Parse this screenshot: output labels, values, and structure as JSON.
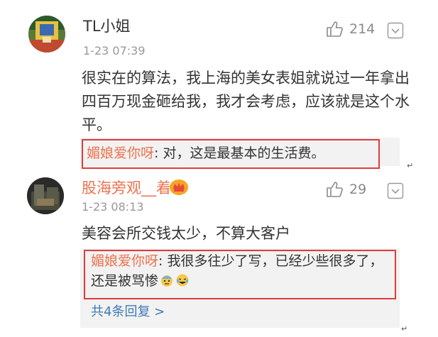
{
  "comments": [
    {
      "username": "TL小姐",
      "timestamp": "1-23 07:39",
      "likes": "214",
      "text": "很实在的算法，我上海的美女表姐就说过一年拿出四百万现金砸给我，我才会考虑，应该就是这个水平。",
      "reply": {
        "author": "媚娘爱你呀",
        "separator": ": ",
        "text": "对，这是最基本的生活费。"
      },
      "paragraph_mark": "↵"
    },
    {
      "username": "股海旁观__着",
      "badge_icon": "vip-crown-icon",
      "timestamp": "1-23 08:13",
      "likes": "29",
      "text": "美容会所交钱太少，不算大客户",
      "reply": {
        "author": "媚娘爱你呀",
        "separator": ": ",
        "text": "我很多往少了写，已经少些很多了，还是被骂惨"
      },
      "more_replies": "共4条回复 >",
      "paragraph_mark": "↵"
    }
  ],
  "colors": {
    "username_vip": "#eb7350",
    "link": "#3d7ab8",
    "highlight_border": "#e03a3a",
    "reply_bg": "#f2f2f2",
    "meta": "#999999"
  }
}
